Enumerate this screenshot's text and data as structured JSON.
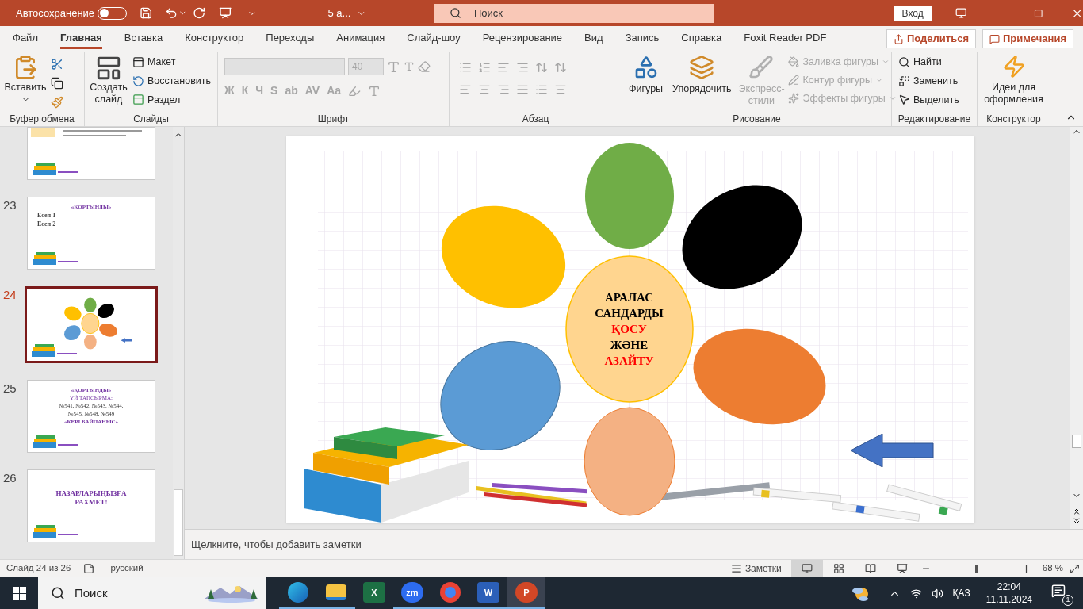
{
  "title_bar": {
    "autosave": {
      "label": "Автосохранение",
      "on": false
    },
    "doc_title": "5 а...",
    "search_placeholder": "Поиск",
    "sign_in": "Вход"
  },
  "tabs": [
    {
      "label": "Файл",
      "selected": false
    },
    {
      "label": "Главная",
      "selected": true
    },
    {
      "label": "Вставка",
      "selected": false
    },
    {
      "label": "Конструктор",
      "selected": false
    },
    {
      "label": "Переходы",
      "selected": false
    },
    {
      "label": "Анимация",
      "selected": false
    },
    {
      "label": "Слайд-шоу",
      "selected": false
    },
    {
      "label": "Рецензирование",
      "selected": false
    },
    {
      "label": "Вид",
      "selected": false
    },
    {
      "label": "Запись",
      "selected": false
    },
    {
      "label": "Справка",
      "selected": false
    },
    {
      "label": "Foxit Reader PDF",
      "selected": false
    }
  ],
  "share": "Поделиться",
  "comments": "Примечания",
  "ribbon": {
    "clipboard": {
      "label": "Буфер обмена",
      "paste": "Вставить"
    },
    "slides": {
      "label": "Слайды",
      "new_slide": "Создать слайд",
      "layout": "Макет",
      "reset": "Восстановить",
      "section": "Раздел"
    },
    "font": {
      "label": "Шрифт",
      "disabled": true,
      "size": "40",
      "styles": [
        "Ж",
        "К",
        "Ч",
        "S",
        "ab",
        "AV",
        "Aa"
      ]
    },
    "paragraph": {
      "label": "Абзац",
      "disabled": true
    },
    "drawing": {
      "label": "Рисование",
      "tools": [
        {
          "label": "Фигуры",
          "disabled": false
        },
        {
          "label": "Упорядочить",
          "disabled": false
        },
        {
          "label": "Экспресс-стили",
          "disabled": true
        }
      ],
      "format": [
        {
          "label": "Заливка фигуры",
          "disabled": true
        },
        {
          "label": "Контур фигуры",
          "disabled": true
        },
        {
          "label": "Эффекты фигуры",
          "disabled": true
        }
      ]
    },
    "editing": {
      "label": "Редактирование",
      "items": [
        "Найти",
        "Заменить",
        "Выделить"
      ]
    },
    "designer": {
      "label": "Конструктор",
      "ideas": "Идеи для оформления"
    }
  },
  "thumbnails": [
    {
      "kind": "partial",
      "selected": false
    },
    {
      "number": "23",
      "kind": "exercises",
      "selected": false,
      "lines": [
        "«ҚОРТЫНДЫ»",
        "Есеп 1",
        "Есеп 2"
      ]
    },
    {
      "number": "24",
      "kind": "flower",
      "selected": true
    },
    {
      "number": "25",
      "kind": "text",
      "selected": false,
      "lines": [
        "«ҚОРТЫНДЫ»",
        "ҮЙ ТАПСЫРМА:",
        "№541,  №542,  №543, №544,",
        "№545,   №548,  №549",
        "«КЕРІ БАЙЛАНЫС»"
      ]
    },
    {
      "number": "26",
      "kind": "text",
      "selected": false,
      "lines": [
        "НАЗАРЛАРЫҢЫЗҒА РАХМЕТ!"
      ]
    }
  ],
  "slide": {
    "center_text": [
      {
        "text": "АРАЛАС",
        "color": "#000000"
      },
      {
        "text": "САНДАРДЫ",
        "color": "#000000"
      },
      {
        "text": "ҚОСУ",
        "color": "#ff0000"
      },
      {
        "text": "ЖӘНЕ",
        "color": "#000000"
      },
      {
        "text": "АЗАЙТУ",
        "color": "#ff0000"
      }
    ]
  },
  "notes_placeholder": "Щелкните, чтобы добавить заметки",
  "status_bar": {
    "slide_info": "Слайд 24 из 26",
    "language": "русский",
    "notes": "Заметки",
    "views": [
      {
        "kind": "normal",
        "selected": true
      },
      {
        "kind": "sorter",
        "selected": false
      },
      {
        "kind": "reading",
        "selected": false
      },
      {
        "kind": "slideshow",
        "selected": false
      }
    ],
    "zoom": {
      "level": 0.5,
      "reading": "68 %"
    }
  },
  "taskbar": {
    "search_placeholder": "Поиск",
    "apps": [
      {
        "kind": "edge",
        "running": true,
        "active": false
      },
      {
        "kind": "explorer",
        "running": true,
        "active": false
      },
      {
        "kind": "excel",
        "label": "X",
        "running": false,
        "active": false
      },
      {
        "kind": "zoom",
        "label": "zm",
        "running": true,
        "active": false
      },
      {
        "kind": "chrome",
        "running": true,
        "active": false
      },
      {
        "kind": "word",
        "label": "W",
        "running": true,
        "active": false
      },
      {
        "kind": "powerpoint",
        "label": "P",
        "running": true,
        "active": true
      }
    ],
    "language": "ҚАЗ",
    "time": "22:04",
    "date": "11.11.2024",
    "notifications": "1"
  }
}
